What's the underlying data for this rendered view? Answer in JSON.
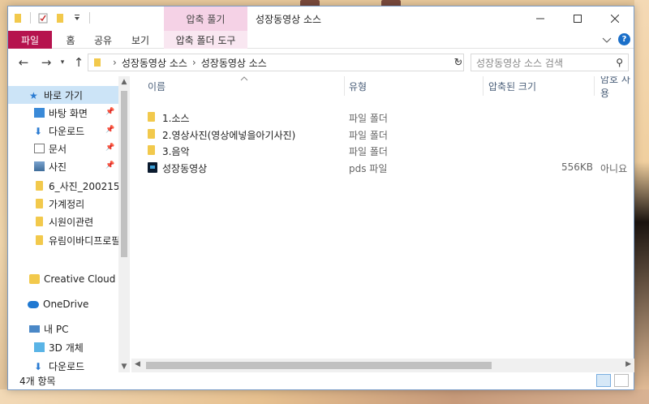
{
  "window": {
    "title": "성장동영상 소스",
    "context_tab_header": "압축 풀기"
  },
  "ribbon": {
    "tabs": [
      "파일",
      "홈",
      "공유",
      "보기",
      "압축 폴더 도구"
    ],
    "help": "?"
  },
  "address": {
    "crumbs": [
      "성장동영상 소스",
      "성장동영상 소스"
    ],
    "search_placeholder": "성장동영상 소스 검색"
  },
  "nav": {
    "items": [
      {
        "label": "바로 가기",
        "icon": "star-icon"
      },
      {
        "label": "바탕 화면",
        "icon": "desktop-icon",
        "pinned": true
      },
      {
        "label": "다운로드",
        "icon": "download-icon",
        "pinned": true
      },
      {
        "label": "문서",
        "icon": "document-icon",
        "pinned": true
      },
      {
        "label": "사진",
        "icon": "picture-icon",
        "pinned": true
      },
      {
        "label": "6_사진_200215",
        "icon": "folder-icon"
      },
      {
        "label": "가계정리",
        "icon": "folder-icon"
      },
      {
        "label": "시원이관련",
        "icon": "folder-icon"
      },
      {
        "label": "유림이바디프로필",
        "icon": "folder-icon"
      },
      {
        "label": "Creative Cloud Files",
        "icon": "creative-cloud-icon"
      },
      {
        "label": "OneDrive",
        "icon": "onedrive-icon"
      },
      {
        "label": "내 PC",
        "icon": "pc-icon"
      },
      {
        "label": "3D 개체",
        "icon": "3d-objects-icon"
      },
      {
        "label": "다운로드",
        "icon": "download-icon"
      }
    ]
  },
  "columns": {
    "name": "이름",
    "type": "유형",
    "compressed_size": "압축된 크기",
    "password": "암호 사용"
  },
  "files": [
    {
      "name": "1.소스",
      "type": "파일 폴더",
      "size": "",
      "password": "",
      "icon": "folder-icon"
    },
    {
      "name": "2.영상사진(영상에넣을아기사진)",
      "type": "파일 폴더",
      "size": "",
      "password": "",
      "icon": "folder-icon"
    },
    {
      "name": "3.음악",
      "type": "파일 폴더",
      "size": "",
      "password": "",
      "icon": "folder-icon"
    },
    {
      "name": "성장동영상",
      "type": "pds 파일",
      "size": "556KB",
      "password": "아니요",
      "icon": "pds-file-icon"
    }
  ],
  "status": {
    "item_count": "4개 항목"
  },
  "colors": {
    "file_tab": "#b6134e",
    "context_tab": "#f5d2e6",
    "selection": "#cce4f7",
    "folder": "#f2c94c"
  }
}
